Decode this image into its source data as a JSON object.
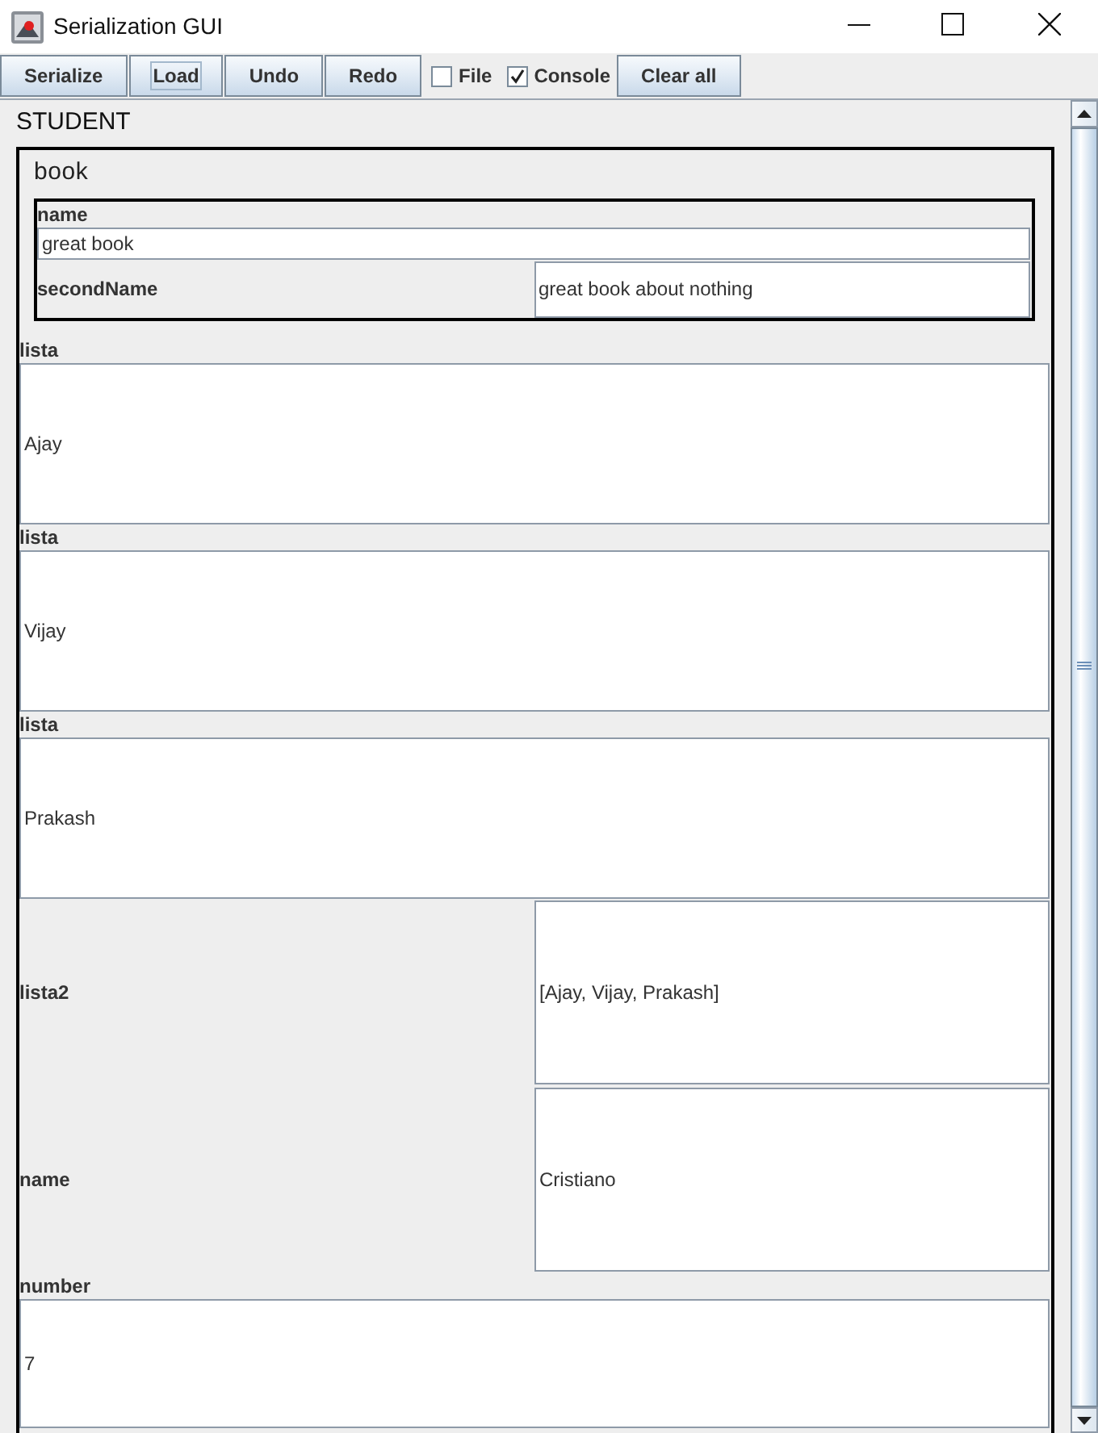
{
  "window": {
    "title": "Serialization GUI"
  },
  "toolbar": [
    {
      "kind": "button",
      "label": "Serialize",
      "focused": false
    },
    {
      "kind": "button",
      "label": "Load",
      "focused": true
    },
    {
      "kind": "button",
      "label": "Undo",
      "focused": false
    },
    {
      "kind": "button",
      "label": "Redo",
      "focused": false
    },
    {
      "kind": "checkbox",
      "label": "File",
      "checked": false
    },
    {
      "kind": "checkbox",
      "label": "Console",
      "checked": true
    },
    {
      "kind": "button",
      "label": "Clear all",
      "focused": false
    }
  ],
  "form": {
    "title": "STUDENT",
    "panel": {
      "title": "book",
      "group": {
        "fields": [
          {
            "kind": "stacked",
            "label": "name",
            "value": "great book"
          },
          {
            "kind": "inline",
            "label": "secondName",
            "value": "great book about nothing"
          }
        ]
      },
      "fields": [
        {
          "kind": "stacked",
          "label": "lista",
          "value": "Ajay"
        },
        {
          "kind": "stacked",
          "label": "lista",
          "value": "Vijay"
        },
        {
          "kind": "stacked",
          "label": "lista",
          "value": "Prakash"
        },
        {
          "kind": "inline",
          "label": "lista2",
          "value": "[Ajay, Vijay, Prakash]"
        },
        {
          "kind": "inline",
          "label": "name",
          "value": "Cristiano"
        },
        {
          "kind": "stacked",
          "label": "number",
          "value": "7"
        }
      ]
    }
  }
}
